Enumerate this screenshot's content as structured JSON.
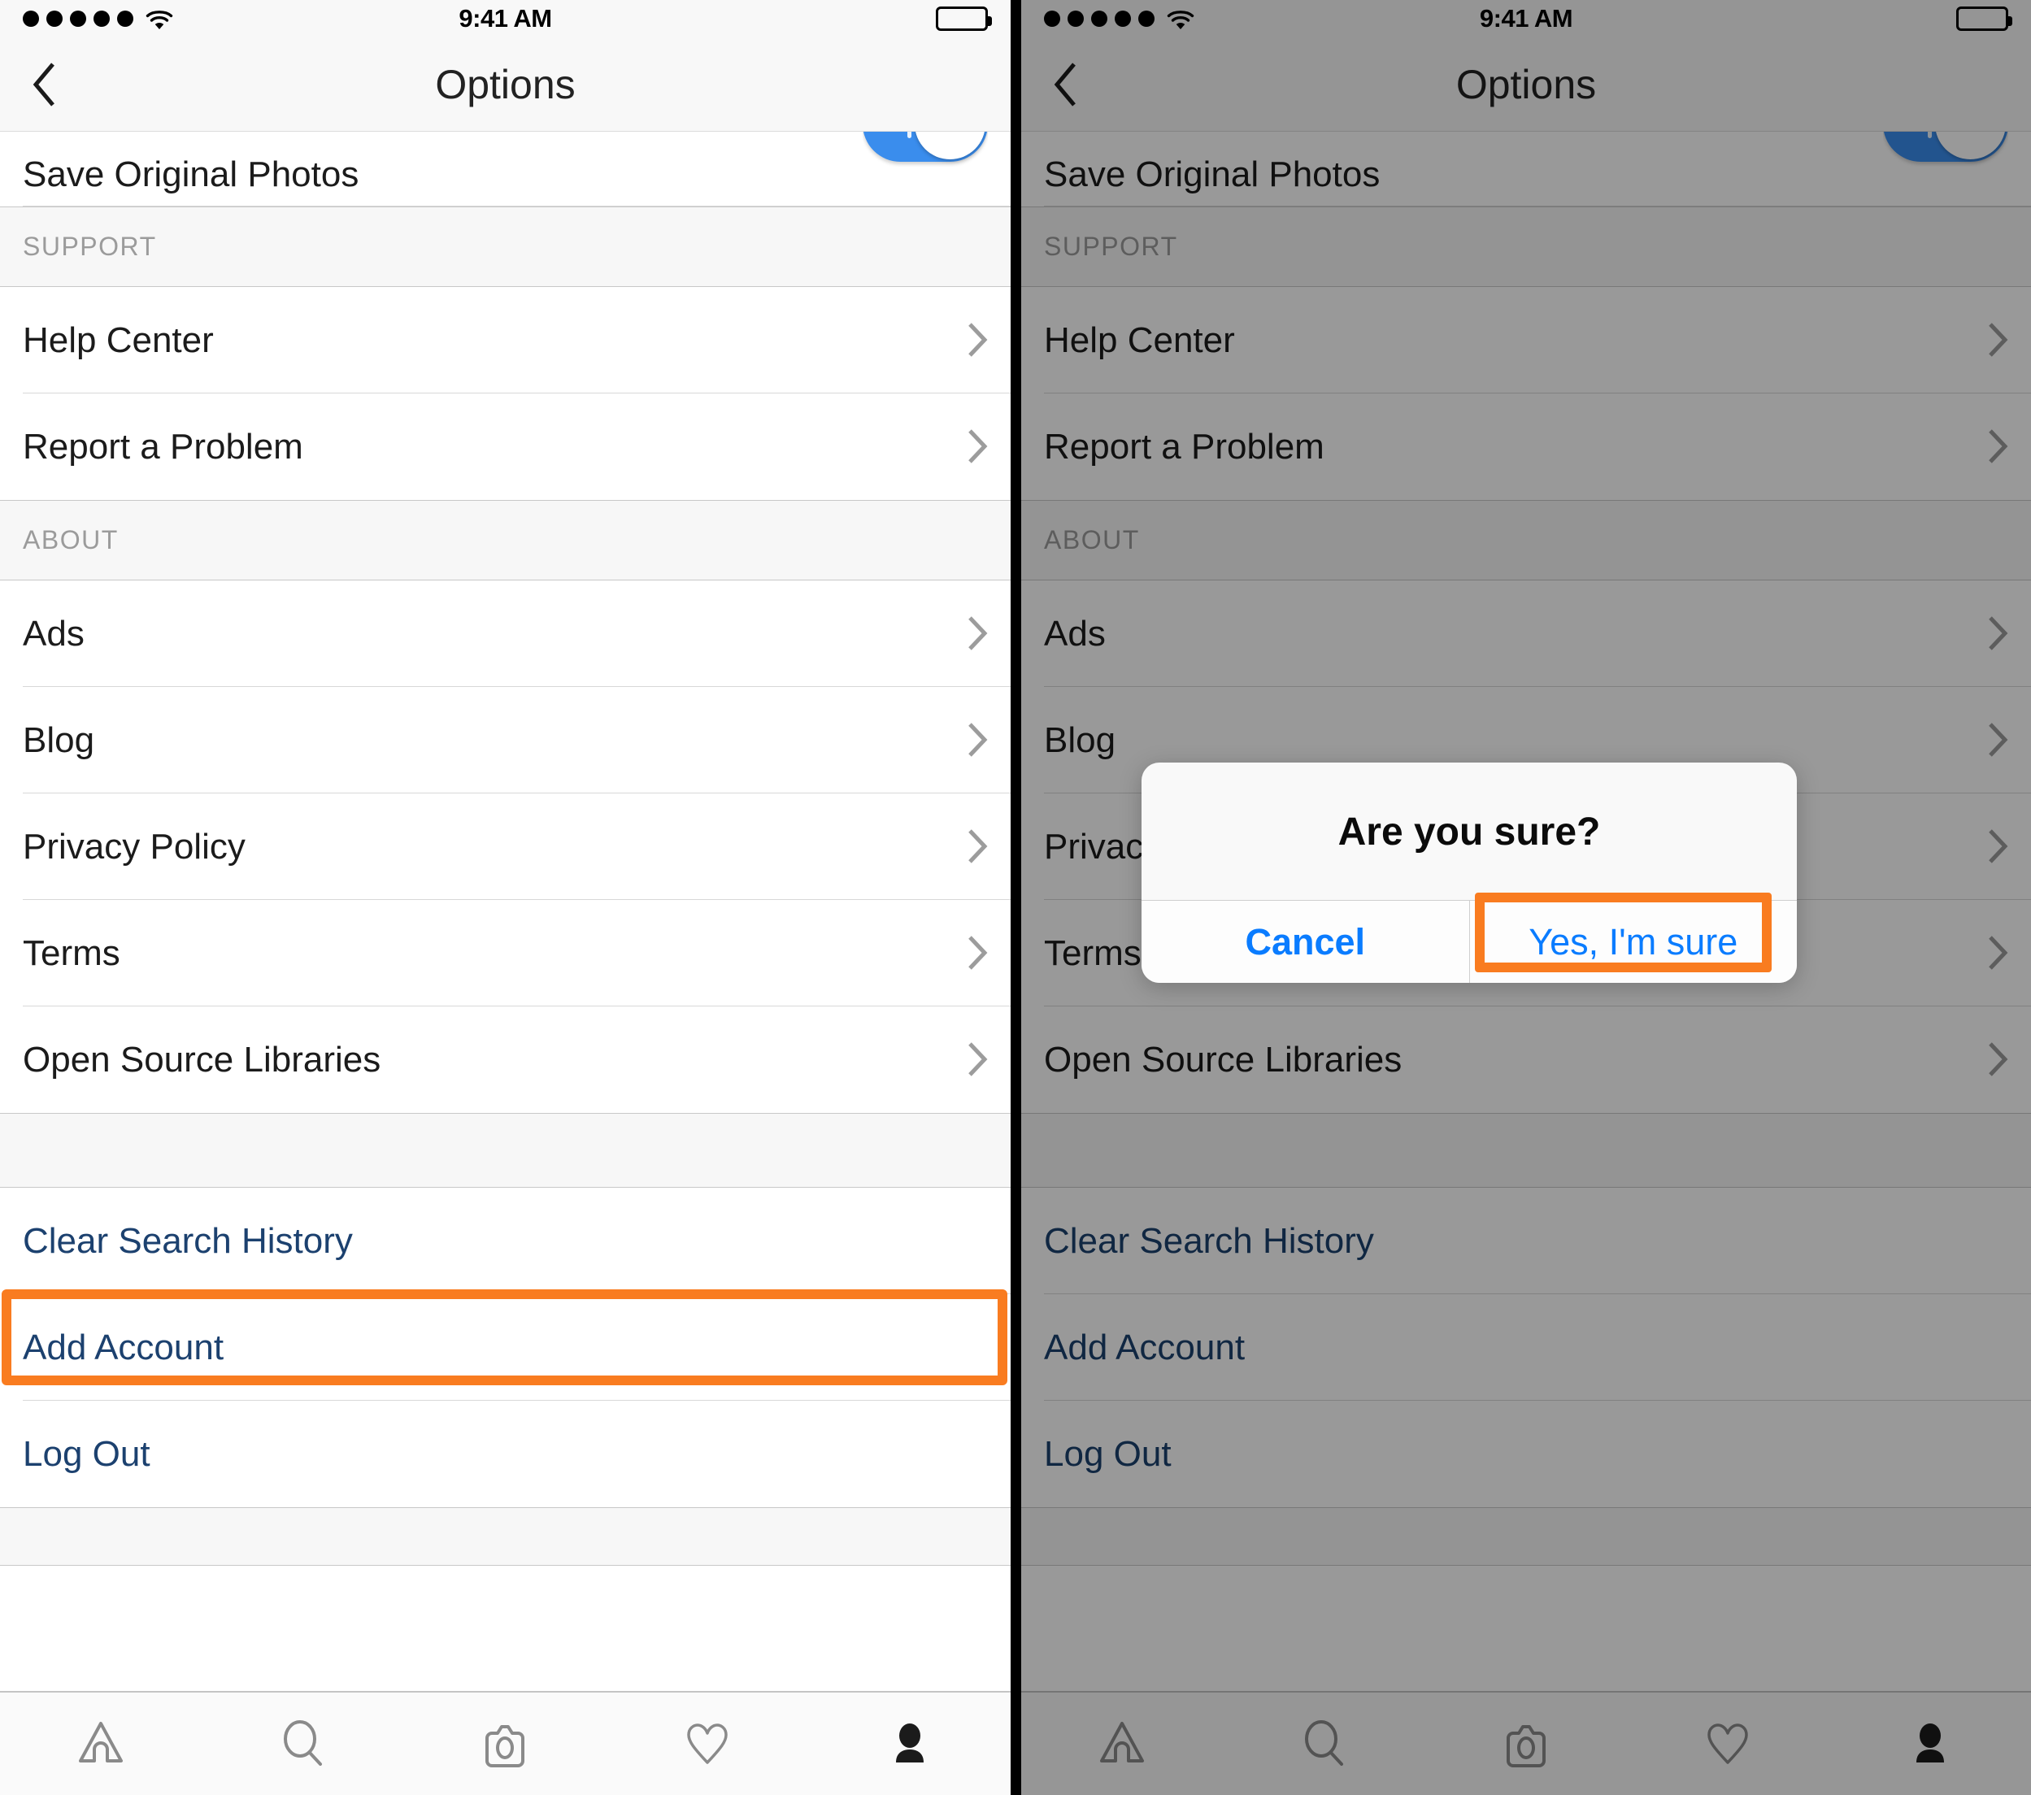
{
  "status_bar": {
    "signal_dots": 5,
    "wifi_icon": "wifi-icon",
    "time": "9:41 AM",
    "battery_icon": "battery-full-icon"
  },
  "nav": {
    "back_icon": "chevron-left-icon",
    "title": "Options"
  },
  "settings": {
    "toggle_row": {
      "label": "Save Original Photos",
      "toggle_on": true,
      "accent": "#3a8ded"
    },
    "sections": [
      {
        "header": "SUPPORT",
        "items": [
          {
            "label": "Help Center",
            "chevron": "chevron-right-icon"
          },
          {
            "label": "Report a Problem",
            "chevron": "chevron-right-icon"
          }
        ]
      },
      {
        "header": "ABOUT",
        "items": [
          {
            "label": "Ads",
            "chevron": "chevron-right-icon"
          },
          {
            "label": "Blog",
            "chevron": "chevron-right-icon"
          },
          {
            "label": "Privacy Policy",
            "chevron": "chevron-right-icon"
          },
          {
            "label": "Terms",
            "chevron": "chevron-right-icon"
          },
          {
            "label": "Open Source Libraries",
            "chevron": "chevron-right-icon"
          }
        ]
      }
    ],
    "actions": [
      {
        "label": "Clear Search History"
      },
      {
        "label": "Add Account"
      },
      {
        "label": "Log Out"
      }
    ],
    "link_color": "#1c416f"
  },
  "tabbar": {
    "tabs": [
      {
        "name": "home-icon",
        "active": false
      },
      {
        "name": "search-icon",
        "active": false
      },
      {
        "name": "camera-icon",
        "active": false
      },
      {
        "name": "heart-icon",
        "active": false
      },
      {
        "name": "profile-icon",
        "active": true
      }
    ]
  },
  "alert": {
    "title": "Are you sure?",
    "cancel_label": "Cancel",
    "confirm_label": "Yes, I'm sure",
    "button_color": "#0a7cff"
  },
  "annotations": {
    "highlight_color": "#f97c20",
    "clear_search_history_box": "Clear Search History",
    "yes_im_sure_box": "Yes, I'm sure"
  }
}
